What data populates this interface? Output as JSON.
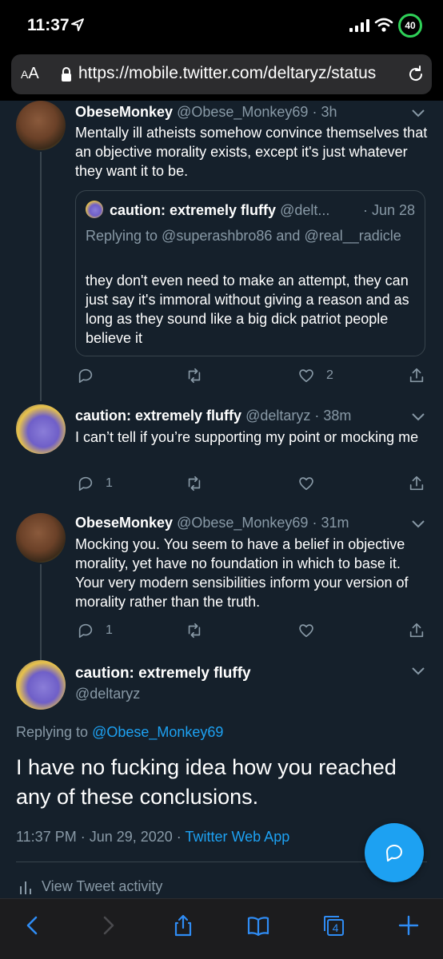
{
  "status": {
    "time": "11:37",
    "battery": "40"
  },
  "browser": {
    "aa_label": "AA",
    "url": "https://mobile.twitter.com/deltaryz/status"
  },
  "tweets": [
    {
      "name": "ObeseMonkey",
      "handle": "@Obese_Monkey69",
      "time": "· 3h",
      "text": "Mentally ill atheists somehow convince themselves that an objective morality exists, except it's just whatever they want it to be.",
      "quote": {
        "name": "caution: extremely fluffy",
        "handle": "@delt...",
        "date": "· Jun 28",
        "replying": "Replying to @superashbro86 and @real__radicle",
        "text": "they don't even need to make an attempt, they can just say it's immoral without giving a reason and as long as they sound like a big dick patriot people believe it"
      },
      "replies": "",
      "likes": "2"
    },
    {
      "name": "caution: extremely fluffy",
      "handle": "@deltaryz",
      "time": "· 38m",
      "text": "I can’t tell if you’re supporting my point or mocking me",
      "replies": "1",
      "likes": ""
    },
    {
      "name": "ObeseMonkey",
      "handle": "@Obese_Monkey69",
      "time": "· 31m",
      "text": "Mocking you. You seem to have a belief in objective morality, yet have no foundation in which to base it. Your very modern sensibilities inform your version of morality rather than the truth.",
      "replies": "1",
      "likes": ""
    }
  ],
  "main_tweet": {
    "name": "caution: extremely fluffy",
    "handle": "@deltaryz",
    "replying_prefix": "Replying to",
    "replying_to": "@Obese_Monkey69",
    "text": "I have no fucking idea how you reached any of these conclusions.",
    "timestamp": "11:37 PM · Jun 29, 2020 ·",
    "source": "Twitter Web App",
    "activity_label": "View Tweet activity"
  },
  "toolbar": {
    "tabs_count": "4"
  },
  "colors": {
    "background": "#15202b",
    "accent": "#1da1f2",
    "muted": "#8899a6",
    "battery": "#2fd158"
  }
}
